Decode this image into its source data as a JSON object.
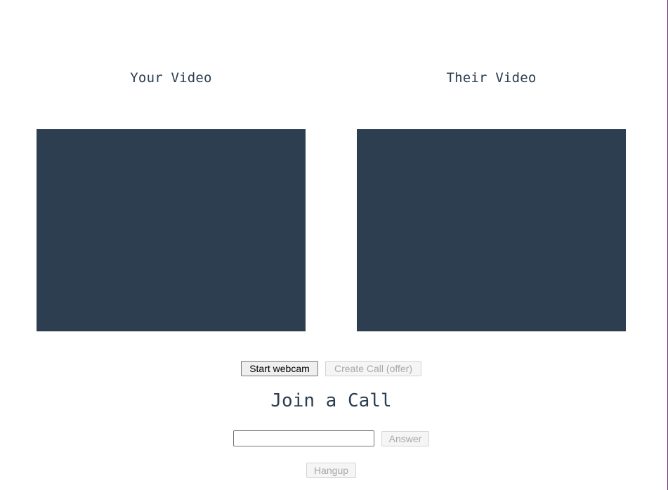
{
  "videos": {
    "yours": {
      "title": "Your Video"
    },
    "theirs": {
      "title": "Their Video"
    }
  },
  "controls": {
    "start_webcam_label": "Start webcam",
    "create_call_label": "Create Call (offer)",
    "join_heading": "Join a Call",
    "call_id_value": "",
    "answer_label": "Answer",
    "hangup_label": "Hangup"
  },
  "colors": {
    "video_background": "#2c3e50",
    "heading_text": "#2c3e50",
    "window_border": "#6b2d7a"
  }
}
